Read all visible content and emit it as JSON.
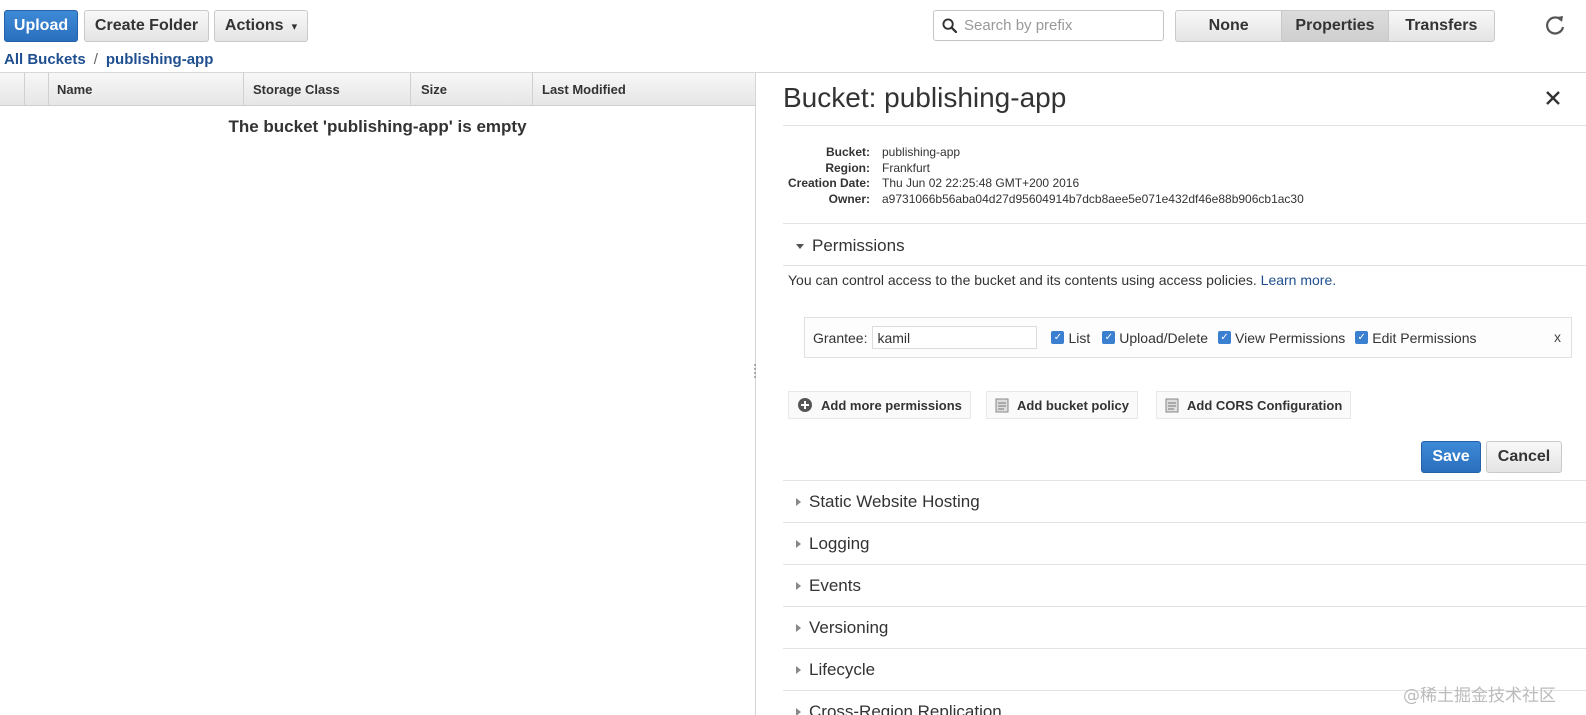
{
  "toolbar": {
    "upload_label": "Upload",
    "create_folder_label": "Create Folder",
    "actions_label": "Actions",
    "search_placeholder": "Search by prefix",
    "views": [
      "None",
      "Properties",
      "Transfers"
    ],
    "active_view": "Properties",
    "accent_color": "#2d74c4"
  },
  "breadcrumb": {
    "root": "All Buckets",
    "separator": "/",
    "current": "publishing-app"
  },
  "table": {
    "columns": [
      "Name",
      "Storage Class",
      "Size",
      "Last Modified"
    ],
    "empty_message": "The bucket 'publishing-app' is empty"
  },
  "properties": {
    "title": "Bucket: publishing-app",
    "info": [
      {
        "label": "Bucket:",
        "value": "publishing-app"
      },
      {
        "label": "Region:",
        "value": "Frankfurt"
      },
      {
        "label": "Creation Date:",
        "value": "Thu Jun 02 22:25:48 GMT+200 2016"
      },
      {
        "label": "Owner:",
        "value": "a9731066b56aba04d27d95604914b7dcb8aee5e071e432df46e88b906cb1ac30"
      }
    ],
    "permissions": {
      "heading": "Permissions",
      "description": "You can control access to the bucket and its contents using access policies.",
      "learn_more": "Learn more.",
      "grantee_label": "Grantee:",
      "grantee_value": "kamil",
      "checkboxes": [
        "List",
        "Upload/Delete",
        "View Permissions",
        "Edit Permissions"
      ],
      "remove_label": "x",
      "add_permissions": "Add more permissions",
      "add_policy": "Add bucket policy",
      "add_cors": "Add CORS Configuration",
      "save_label": "Save",
      "cancel_label": "Cancel"
    },
    "sections": [
      "Static Website Hosting",
      "Logging",
      "Events",
      "Versioning",
      "Lifecycle",
      "Cross-Region Replication"
    ]
  },
  "watermark": "@稀土掘金技术社区"
}
